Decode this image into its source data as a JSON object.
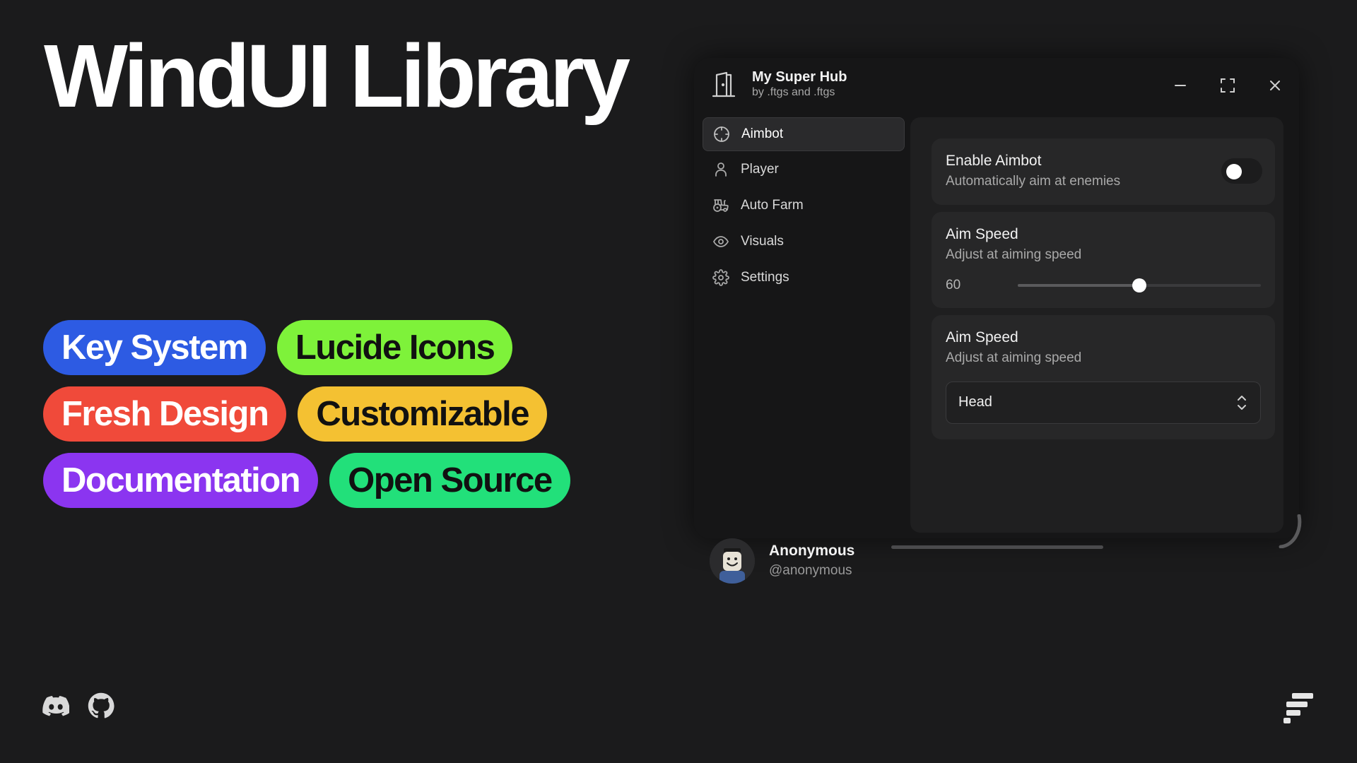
{
  "hero": {
    "title": "WindUI Library"
  },
  "features": [
    {
      "label": "Key System",
      "bg": "#2d5be3",
      "fg": "#ffffff"
    },
    {
      "label": "Lucide Icons",
      "bg": "#7ef23a",
      "fg": "#111111"
    },
    {
      "label": "Fresh Design",
      "bg": "#f04a3a",
      "fg": "#ffffff"
    },
    {
      "label": "Customizable",
      "bg": "#f4c132",
      "fg": "#111111"
    },
    {
      "label": "Documentation",
      "bg": "#8b35f0",
      "fg": "#ffffff"
    },
    {
      "label": "Open Source",
      "bg": "#22e07a",
      "fg": "#111111"
    }
  ],
  "social": {
    "discord_icon": "discord-icon",
    "github_icon": "github-icon"
  },
  "window": {
    "title": "My Super Hub",
    "subtitle": "by .ftgs and .ftgs",
    "icon": "door-open-icon",
    "controls": [
      "minimize-icon",
      "maximize-icon",
      "close-icon"
    ]
  },
  "sidebar": {
    "items": [
      {
        "label": "Aimbot",
        "icon": "crosshair-icon",
        "active": true
      },
      {
        "label": "Player",
        "icon": "user-icon",
        "active": false
      },
      {
        "label": "Auto Farm",
        "icon": "tractor-icon",
        "active": false
      },
      {
        "label": "Visuals",
        "icon": "eye-icon",
        "active": false
      },
      {
        "label": "Settings",
        "icon": "settings-icon",
        "active": false
      }
    ]
  },
  "user": {
    "name": "Anonymous",
    "handle": "@anonymous"
  },
  "settings": {
    "toggle": {
      "title": "Enable Aimbot",
      "desc": "Automatically aim at enemies",
      "enabled": false
    },
    "slider": {
      "title": "Aim Speed",
      "desc": "Adjust at aiming speed",
      "value": "60",
      "fraction": 0.5
    },
    "dropdown": {
      "title": "Aim Speed",
      "desc": "Adjust at aiming speed",
      "selected": "Head"
    }
  }
}
